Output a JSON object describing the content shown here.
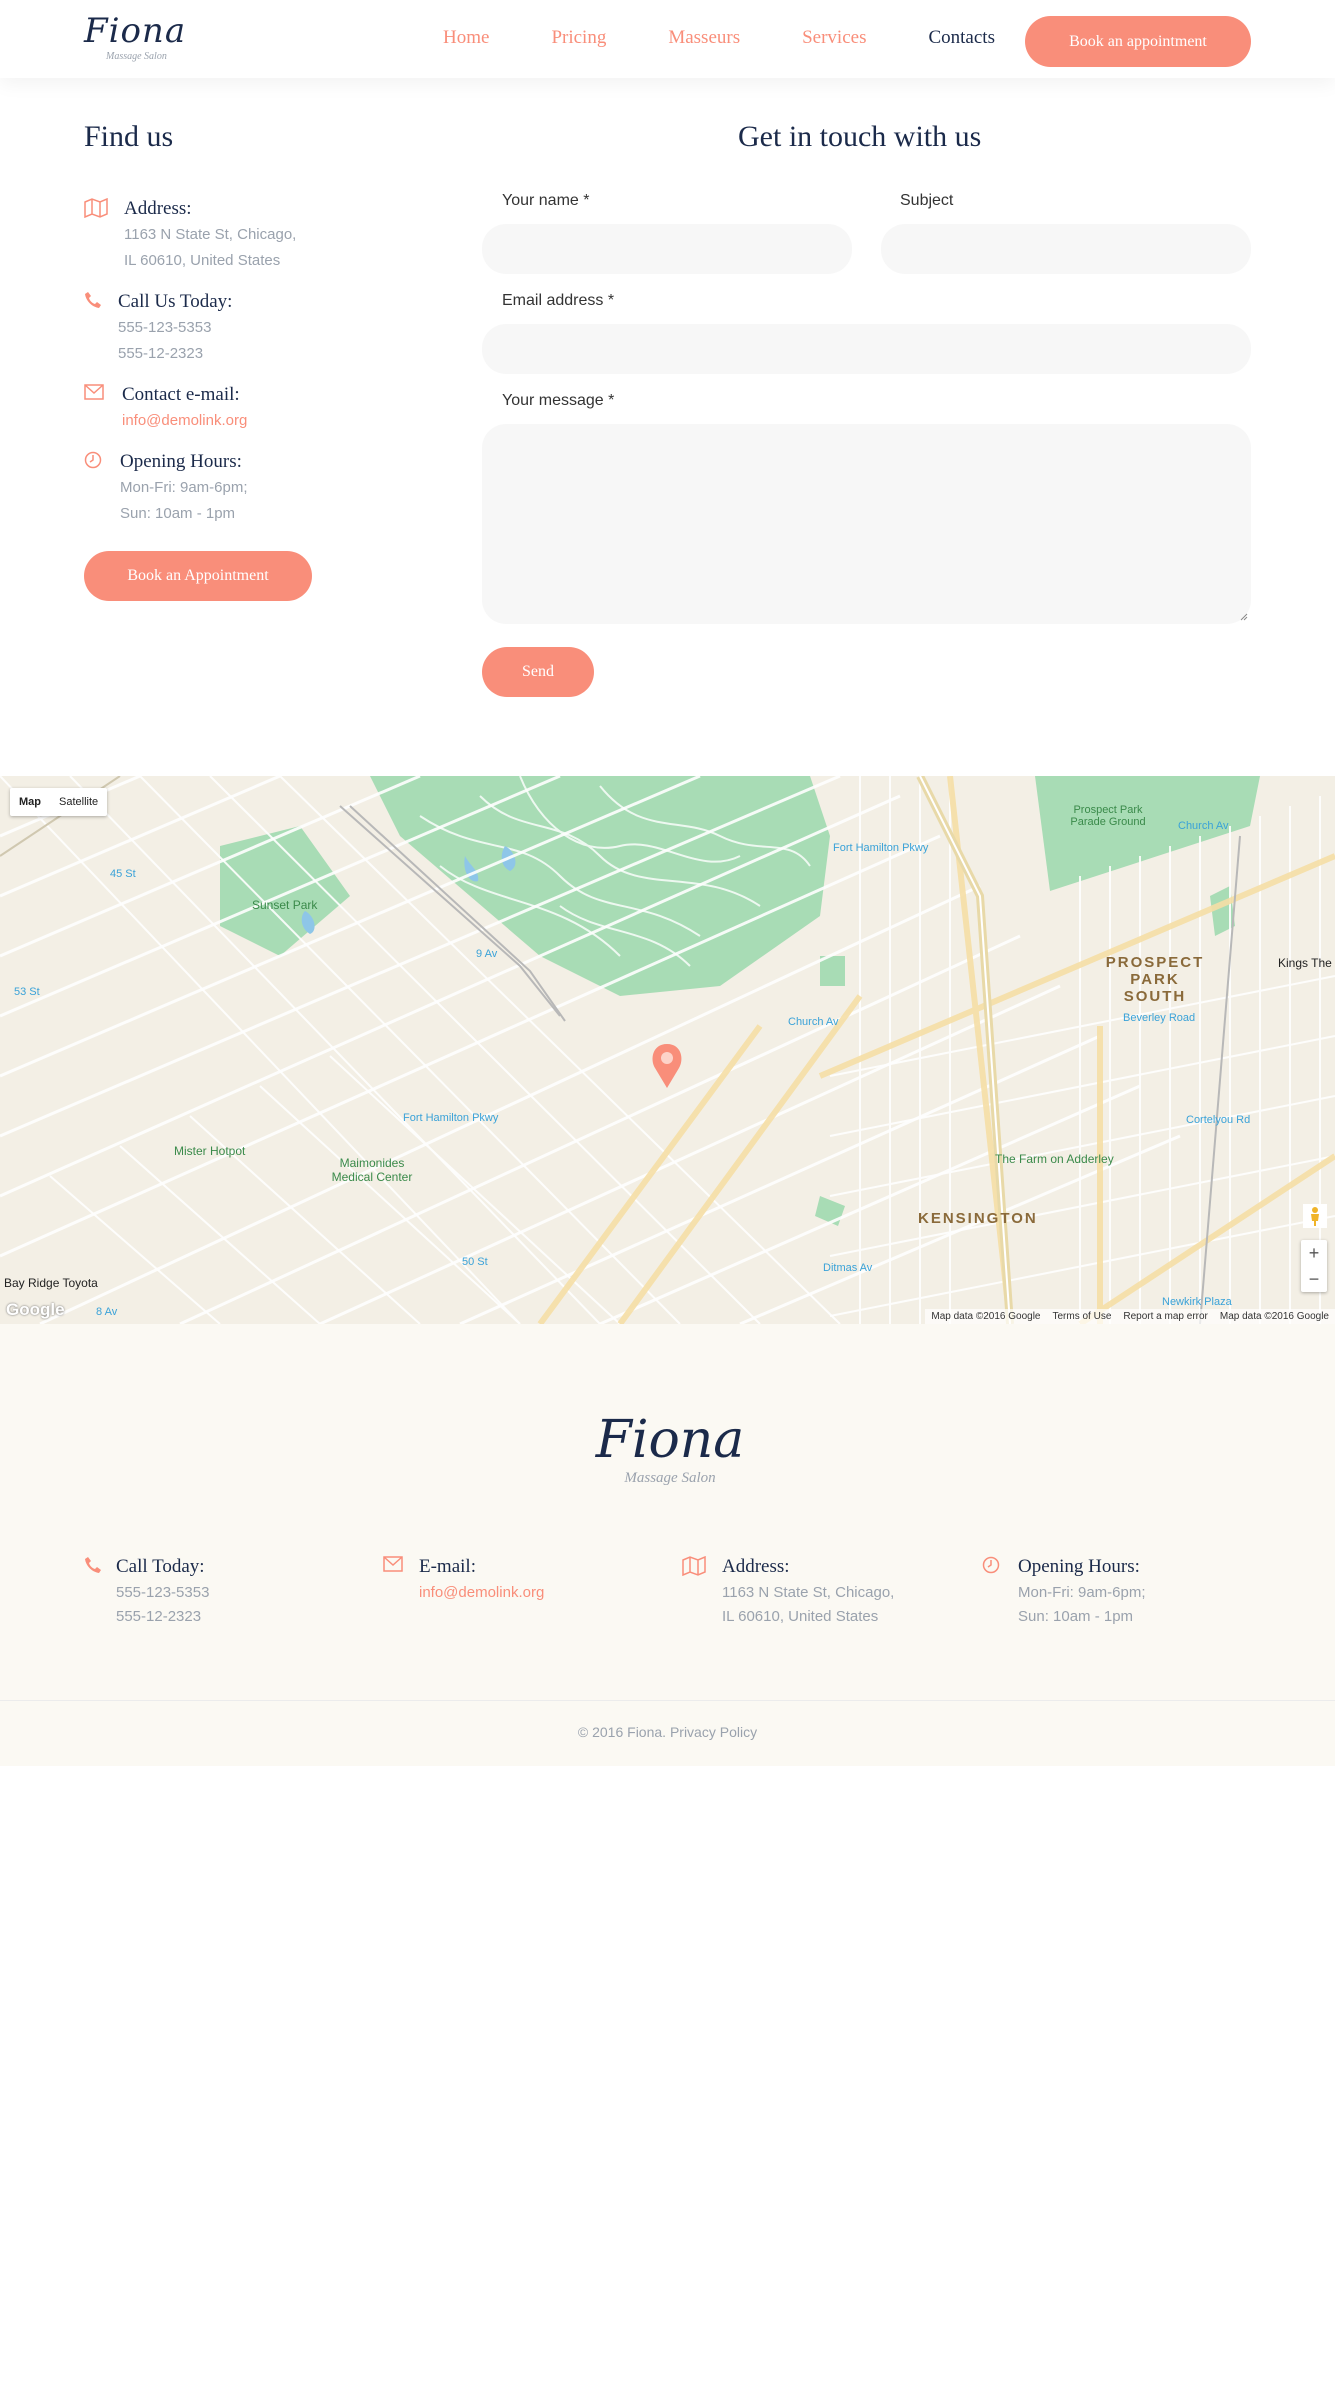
{
  "header": {
    "logo": {
      "word": "Fiona",
      "tagline": "Massage Salon"
    },
    "nav": [
      "Home",
      "Pricing",
      "Masseurs",
      "Services",
      "Contacts"
    ],
    "active_nav": "Contacts",
    "cta": "Book an appointment"
  },
  "find_us": {
    "title": "Find us",
    "address": {
      "title": "Address:",
      "lines": [
        "1163 N State St, Chicago,",
        "IL 60610, United States"
      ]
    },
    "phone": {
      "title": "Call Us Today:",
      "lines": [
        "555-123-5353",
        "555-12-2323"
      ]
    },
    "email": {
      "title": "Contact e-mail:",
      "value": "info@demolink.org"
    },
    "hours": {
      "title": "Opening Hours:",
      "lines": [
        "Mon-Fri: 9am-6pm;",
        "Sun: 10am - 1pm"
      ]
    },
    "button": "Book an Appointment"
  },
  "contact_form": {
    "title": "Get in touch with us",
    "name_label": "Your name *",
    "subject_label": "Subject",
    "email_label": "Email address *",
    "message_label": "Your message *",
    "submit": "Send"
  },
  "map": {
    "types": [
      "Map",
      "Satellite"
    ],
    "selected_type": "Map",
    "labels": {
      "sunset_park": "Sunset Park",
      "prospect_park_south": "PROSPECT PARK SOUTH",
      "kensington": "KENSINGTON",
      "kings_the": "Kings The",
      "mister_hotpot": "Mister Hotpot",
      "maimonides": "Maimonides Medical Center",
      "farm_adderley": "The Farm on Adderley",
      "bay_ridge_toyota": "Bay Ridge Toyota",
      "prospect_park_parade": "Prospect Park Parade Ground",
      "fort_hamilton_pkwy": "Fort Hamilton Pkwy",
      "fort_hamilton_pkwy_2": "Fort Hamilton Pkwy",
      "church_av": "Church Av",
      "church_av_2": "Church Av",
      "beverley_rd": "Beverley Road",
      "cortelyou_rd": "Cortelyou Rd",
      "ditmas_av": "Ditmas Av",
      "newkirk_plaza": "Newkirk Plaza",
      "av_45": "45 St",
      "av_53": "53 St",
      "av_9": "9 Av",
      "st_50": "50 St",
      "av_8": "8 Av",
      "google": "Google"
    },
    "footer": [
      "Map data ©2016 Google",
      "Terms of Use",
      "Report a map error",
      "Map data ©2016 Google"
    ],
    "zoom_in": "+",
    "zoom_out": "−"
  },
  "footer": {
    "logo": {
      "word": "Fiona",
      "tagline": "Massage Salon"
    },
    "call": {
      "title": "Call Today:",
      "lines": [
        "555-123-5353",
        "555-12-2323"
      ]
    },
    "email": {
      "title": "E-mail:",
      "value": "info@demolink.org"
    },
    "address": {
      "title": "Address:",
      "lines": [
        "1163 N State St, Chicago,",
        "IL 60610, United States"
      ]
    },
    "hours": {
      "title": "Opening Hours:",
      "lines": [
        "Mon-Fri: 9am-6pm;",
        "Sun: 10am - 1pm"
      ]
    },
    "copyright": "© 2016 Fiona. Privacy Policy"
  },
  "colors": {
    "accent": "#f98e7a",
    "navy": "#1b2a4a",
    "muted": "#9aa2ad",
    "footer_bg": "#fbf9f3"
  }
}
